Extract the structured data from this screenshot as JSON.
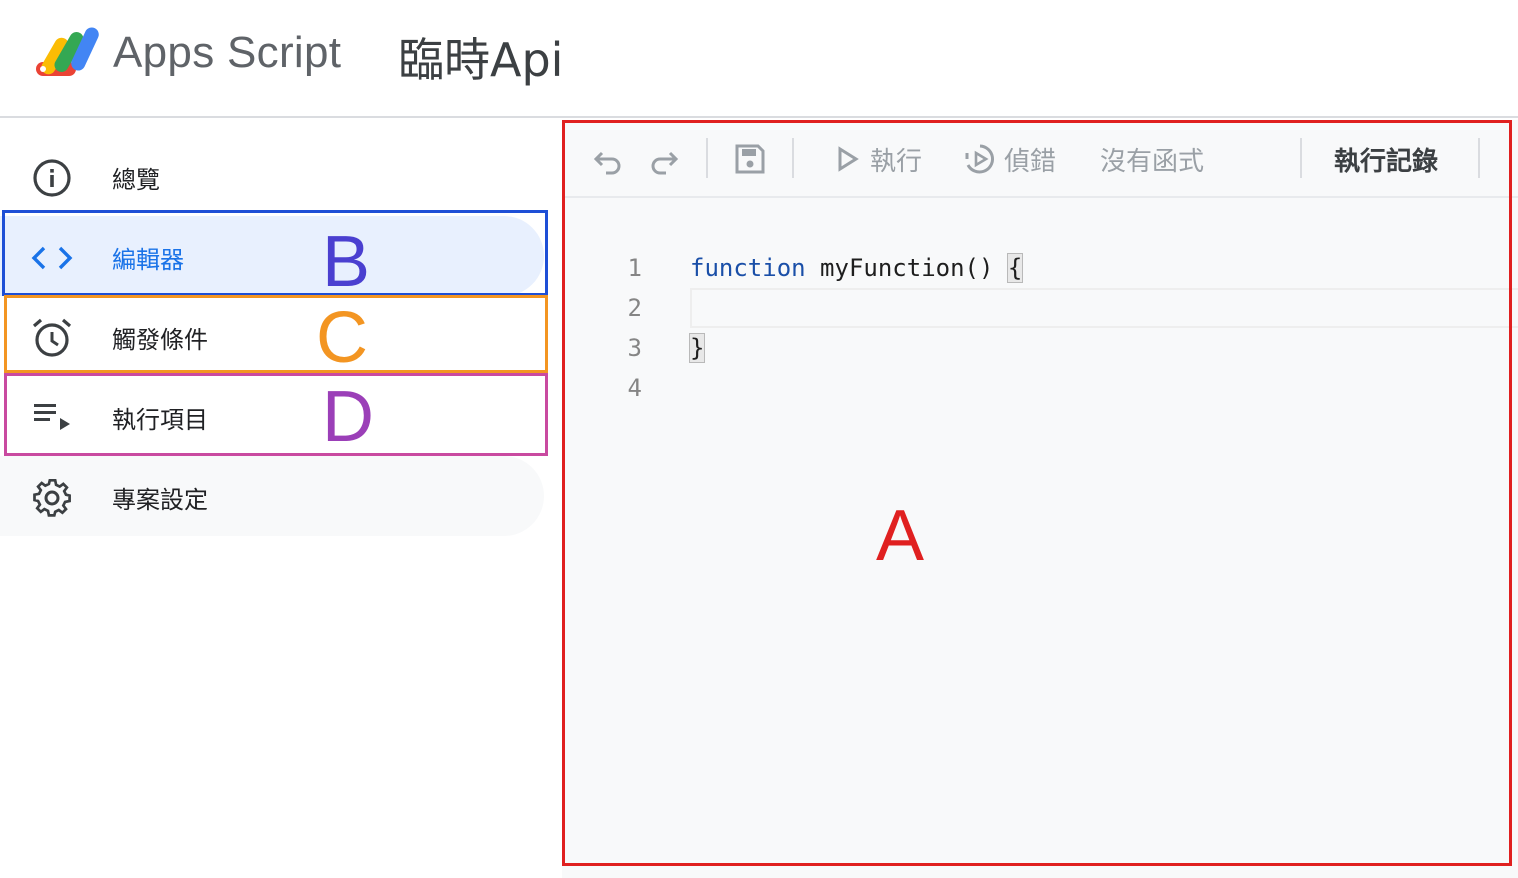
{
  "header": {
    "brand": "Apps Script",
    "project_title": "臨時Api"
  },
  "sidebar": {
    "items": [
      {
        "label": "總覽",
        "icon": "info-icon"
      },
      {
        "label": "編輯器",
        "icon": "code-icon"
      },
      {
        "label": "觸發條件",
        "icon": "alarm-icon"
      },
      {
        "label": "執行項目",
        "icon": "list-play-icon"
      },
      {
        "label": "專案設定",
        "icon": "gear-icon"
      }
    ]
  },
  "annotations": {
    "a": "A",
    "b": "B",
    "c": "C",
    "d": "D"
  },
  "toolbar": {
    "run": "執行",
    "debug": "偵錯",
    "function_select": "沒有函式",
    "logs": "執行記錄"
  },
  "editor": {
    "line_numbers": [
      "1",
      "2",
      "3",
      "4"
    ],
    "code": {
      "keyword": "function",
      "signature": " myFunction() ",
      "open_brace": "{",
      "close_brace": "}"
    }
  },
  "colors": {
    "active_blue": "#1a73e8",
    "box_a": "#e02020",
    "box_b": "#1e4fd6",
    "box_c": "#f39522",
    "box_d": "#c94aa0",
    "letter_b": "#4a3fd0",
    "letter_d": "#9b3fb8"
  }
}
